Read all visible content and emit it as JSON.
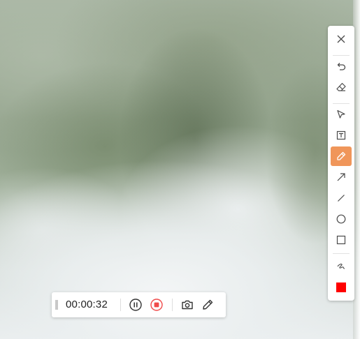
{
  "recording": {
    "elapsed_time": "00:00:32",
    "icons": {
      "drag": "grip-dots-icon",
      "pause": "pause-circle-icon",
      "stop": "stop-circle-icon",
      "screenshot": "camera-icon",
      "annotate": "pencil-icon"
    }
  },
  "annotation_toolbar": {
    "tools": [
      "close",
      "undo",
      "eraser",
      "select",
      "text",
      "highlighter",
      "arrow",
      "line",
      "ellipse",
      "rectangle",
      "freehand"
    ],
    "active_tool": "highlighter",
    "accent_color": "#f0965a",
    "selected_color": "#ff0000"
  },
  "colors": {
    "stop": "#f04b4b",
    "icon": "#4a4a4a"
  }
}
